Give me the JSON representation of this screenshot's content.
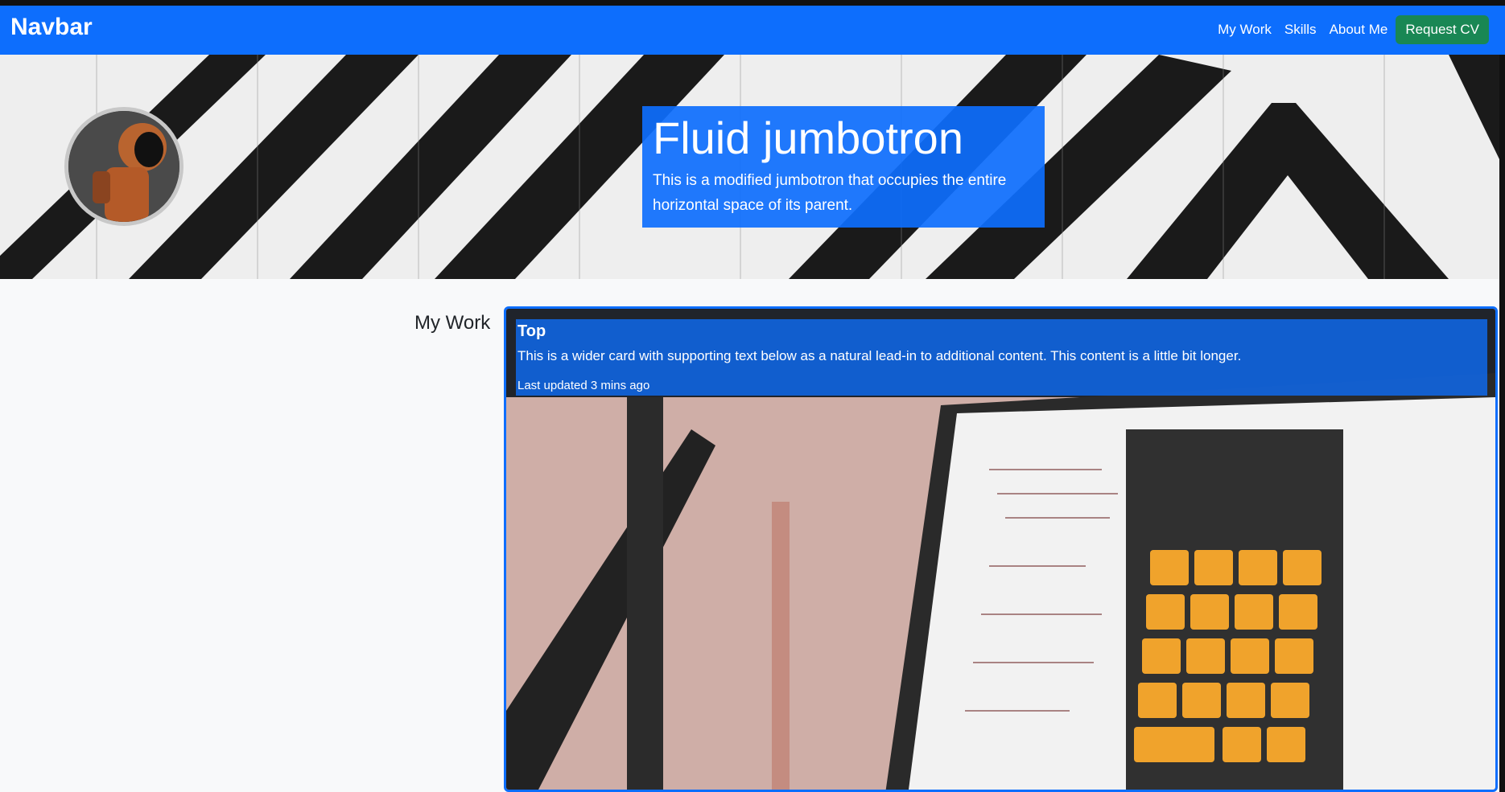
{
  "navbar": {
    "brand": "Navbar",
    "links": [
      "My Work",
      "Skills",
      "About Me"
    ],
    "cta": "Request CV"
  },
  "jumbotron": {
    "title": "Fluid jumbotron",
    "lead": "This is a modified jumbotron that occupies the entire horizontal space of its parent."
  },
  "section": {
    "title": "My Work"
  },
  "card": {
    "title": "Top",
    "text": "This is a wider card with supporting text below as a natural lead-in to additional content. This content is a little bit longer.",
    "meta": "Last updated 3 mins ago"
  },
  "colors": {
    "primary": "#0d6efd",
    "success": "#198754"
  }
}
